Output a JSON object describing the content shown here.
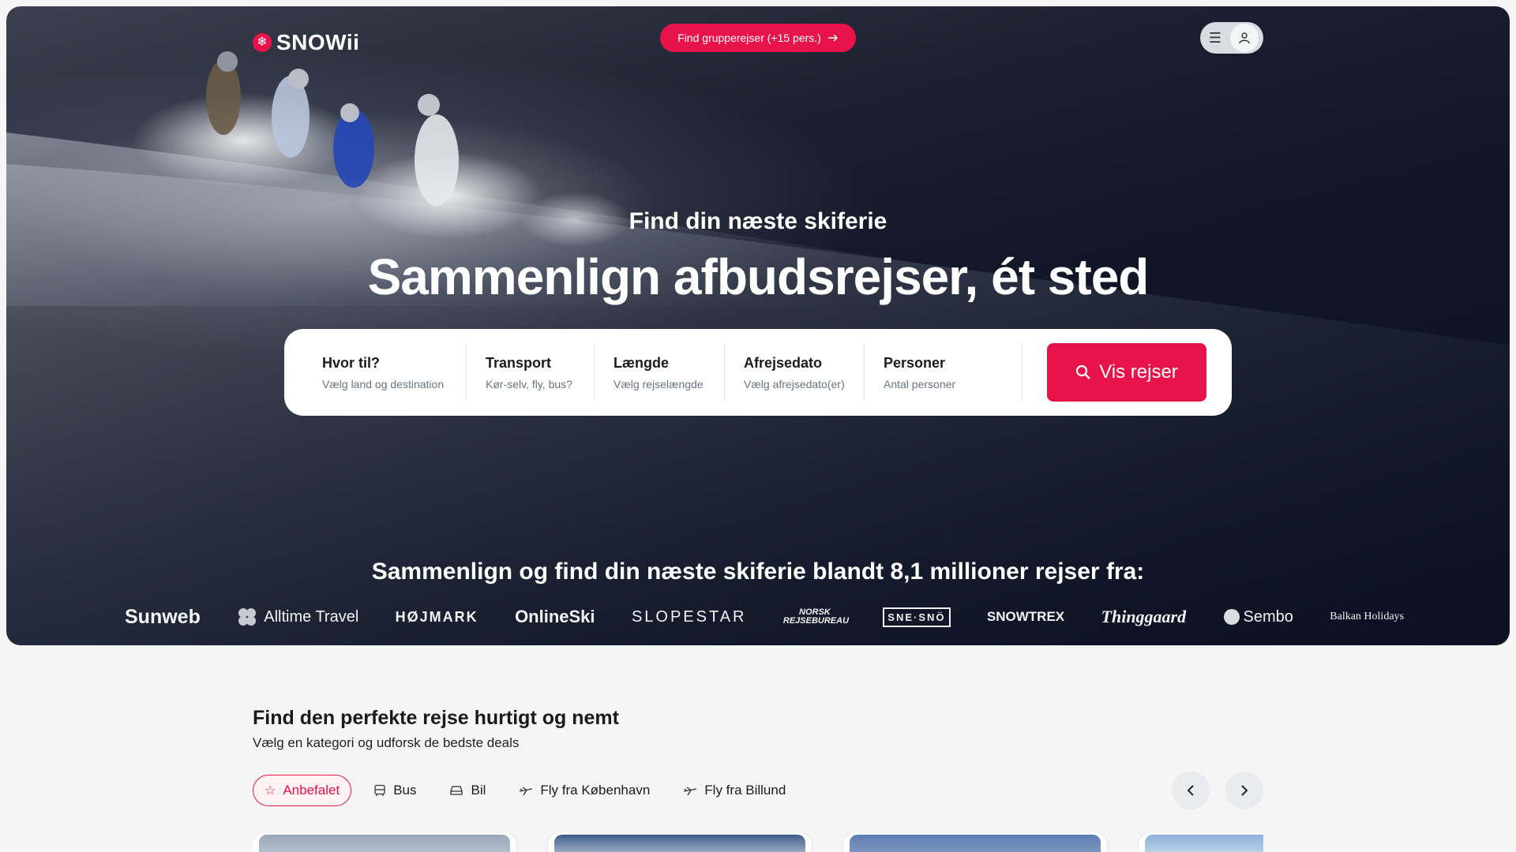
{
  "brand": {
    "name": "SNOWii",
    "accent": "#e8134a"
  },
  "topbar": {
    "group_button": "Find grupperejser (+15 pers.)",
    "menu_icon": "hamburger-icon",
    "user_icon": "user-icon"
  },
  "hero": {
    "subtitle": "Find din næste skiferie",
    "headline": "Sammenlign afbudsrejser, ét sted"
  },
  "search": {
    "fields": [
      {
        "label": "Hvor til?",
        "hint": "Vælg land og destination"
      },
      {
        "label": "Transport",
        "hint": "Kør-selv, fly, bus?"
      },
      {
        "label": "Længde",
        "hint": "Vælg rejselængde"
      },
      {
        "label": "Afrejsedato",
        "hint": "Vælg afrejsedato(er)"
      },
      {
        "label": "Personer",
        "hint": "Antal personer"
      }
    ],
    "button": "Vis rejser"
  },
  "compare": {
    "title": "Sammenlign og find din næste skiferie blandt 8,1 millioner rejser fra:",
    "partners": [
      "Sunweb",
      "Alltime Travel",
      "HØJMARK",
      "OnlineSki",
      "SLOPESTAR",
      "NORSK REJSEBUREAU",
      "SNE·SNÖ",
      "SNOWTREX",
      "Thinggaard",
      "Sembo",
      "Balkan Holidays"
    ]
  },
  "categories_section": {
    "title": "Find den perfekte rejse hurtigt og nemt",
    "subtitle": "Vælg en kategori og udforsk de bedste deals",
    "categories": [
      {
        "label": "Anbefalet",
        "icon": "star-icon",
        "active": true
      },
      {
        "label": "Bus",
        "icon": "bus-icon",
        "active": false
      },
      {
        "label": "Bil",
        "icon": "car-icon",
        "active": false
      },
      {
        "label": "Fly fra København",
        "icon": "plane-icon",
        "active": false
      },
      {
        "label": "Fly fra Billund",
        "icon": "plane-icon",
        "active": false
      }
    ],
    "prev_icon": "chevron-left-icon",
    "next_icon": "chevron-right-icon"
  }
}
